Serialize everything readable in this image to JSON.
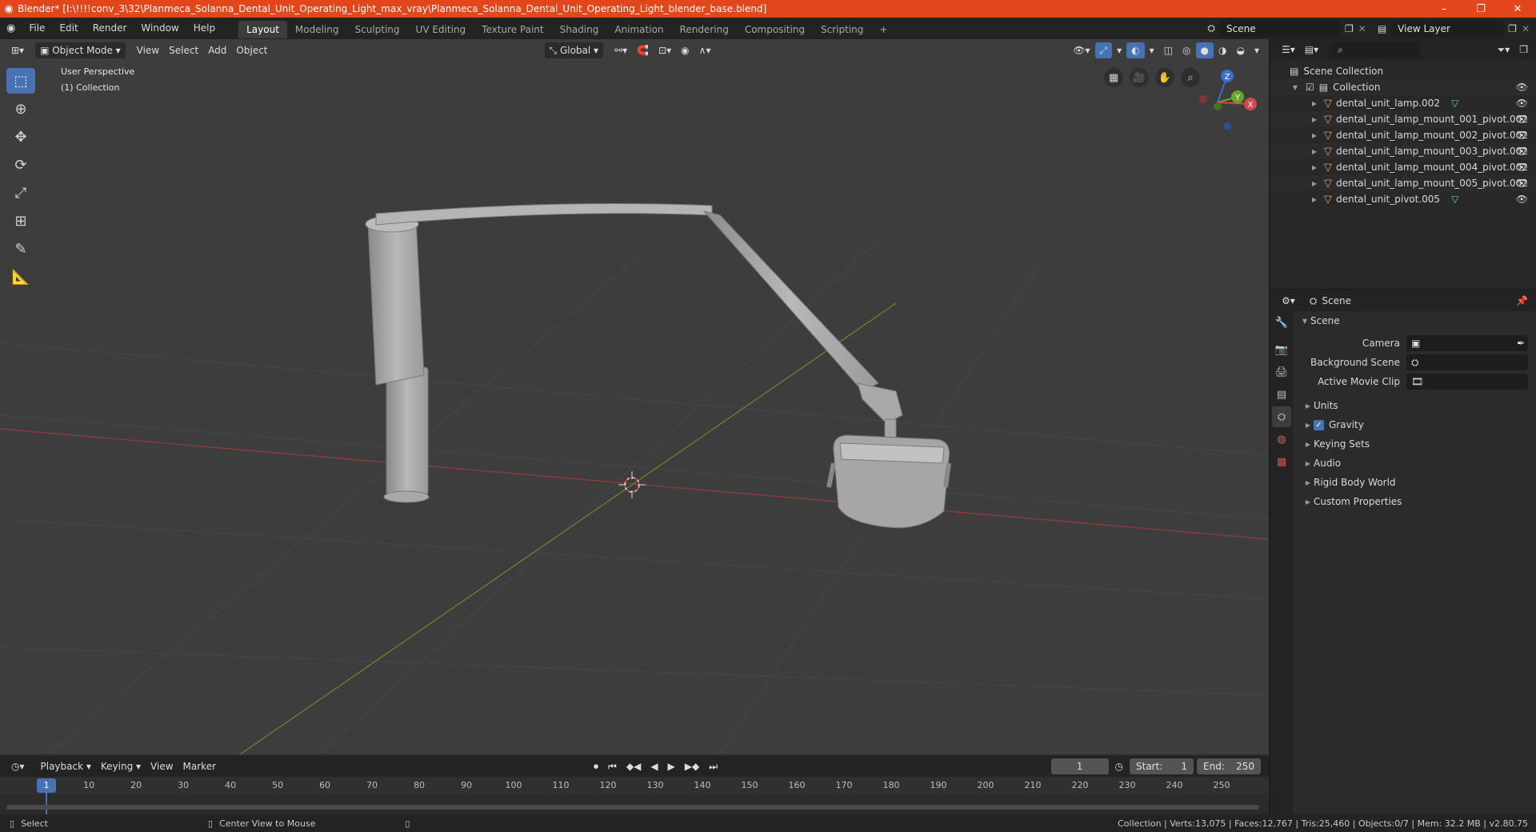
{
  "titlebar": {
    "title": "Blender* [I:\\!!!!conv_3\\32\\Planmeca_Solanna_Dental_Unit_Operating_Light_max_vray\\Planmeca_Solanna_Dental_Unit_Operating_Light_blender_base.blend]",
    "minimize": "–",
    "restore": "❐",
    "close": "✕"
  },
  "menus": [
    "File",
    "Edit",
    "Render",
    "Window",
    "Help"
  ],
  "workspaces": [
    "Layout",
    "Modeling",
    "Sculpting",
    "UV Editing",
    "Texture Paint",
    "Shading",
    "Animation",
    "Rendering",
    "Compositing",
    "Scripting"
  ],
  "workspace_add": "+",
  "scene_field": "Scene",
  "view_layer_field": "View Layer",
  "viewport_header": {
    "mode": "Object Mode",
    "menus": [
      "View",
      "Select",
      "Add",
      "Object"
    ],
    "orientation": "Global"
  },
  "viewport_overlay": {
    "perspective": "User Perspective",
    "collection": "(1) Collection"
  },
  "gizmo": {
    "z": "Z",
    "y": "Y",
    "x": "X"
  },
  "outliner": {
    "root": "Scene Collection",
    "collection": "Collection",
    "items": [
      {
        "name": "dental_unit_lamp.002",
        "has_mesh": true
      },
      {
        "name": "dental_unit_lamp_mount_001_pivot.002",
        "has_mesh": false
      },
      {
        "name": "dental_unit_lamp_mount_002_pivot.002",
        "has_mesh": false
      },
      {
        "name": "dental_unit_lamp_mount_003_pivot.002",
        "has_mesh": false
      },
      {
        "name": "dental_unit_lamp_mount_004_pivot.002",
        "has_mesh": false
      },
      {
        "name": "dental_unit_lamp_mount_005_pivot.002",
        "has_mesh": false
      },
      {
        "name": "dental_unit_pivot.005",
        "has_mesh": true
      }
    ]
  },
  "properties": {
    "header": "Scene",
    "panel_title": "Scene",
    "fields": [
      {
        "label": "Camera"
      },
      {
        "label": "Background Scene"
      },
      {
        "label": "Active Movie Clip"
      }
    ],
    "subpanels": [
      "Units",
      "Gravity",
      "Keying Sets",
      "Audio",
      "Rigid Body World",
      "Custom Properties"
    ]
  },
  "timeline": {
    "menus": [
      "Playback",
      "Keying",
      "View",
      "Marker"
    ],
    "current_frame": "1",
    "start_label": "Start:",
    "start": "1",
    "end_label": "End:",
    "end": "250",
    "ticks": [
      "1",
      "10",
      "20",
      "30",
      "40",
      "50",
      "60",
      "70",
      "80",
      "90",
      "100",
      "110",
      "120",
      "130",
      "140",
      "150",
      "160",
      "170",
      "180",
      "190",
      "200",
      "210",
      "220",
      "230",
      "240",
      "250"
    ]
  },
  "statusbar": {
    "select": "Select",
    "center": "Center View to Mouse",
    "stats": "Collection | Verts:13,075 | Faces:12,767 | Tris:25,460 | Objects:0/7 | Mem: 32.2 MB | v2.80.75"
  }
}
